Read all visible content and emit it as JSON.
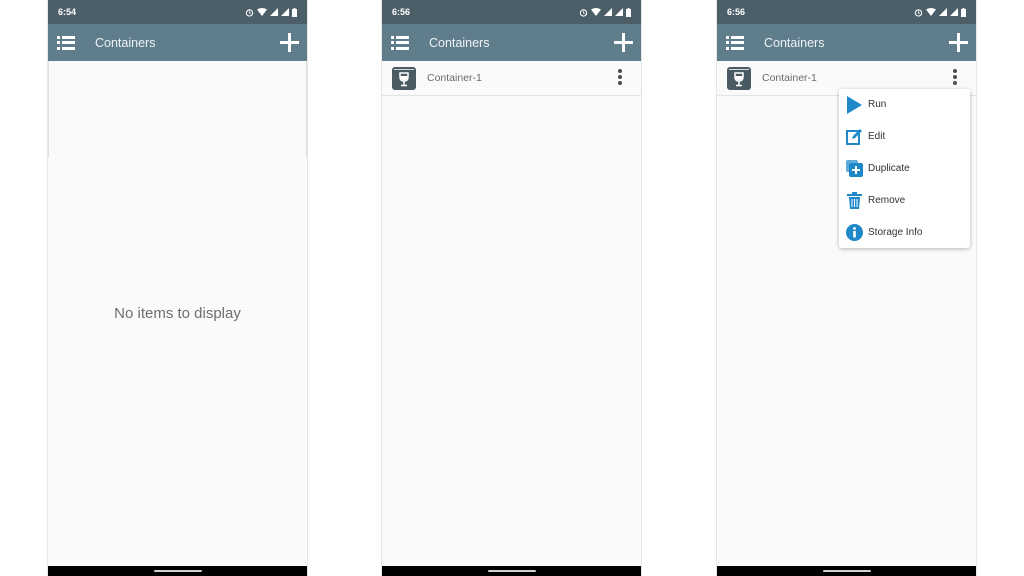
{
  "screens": [
    {
      "status_time": "6:54",
      "app_title": "Containers",
      "empty_message": "No items to display"
    },
    {
      "status_time": "6:56",
      "app_title": "Containers",
      "items": [
        {
          "label": "Container-1",
          "icon": "container-icon"
        }
      ]
    },
    {
      "status_time": "6:56",
      "app_title": "Containers",
      "items": [
        {
          "label": "Container-1",
          "icon": "container-icon"
        }
      ],
      "context_menu": [
        {
          "label": "Run",
          "icon": "play-icon"
        },
        {
          "label": "Edit",
          "icon": "edit-icon"
        },
        {
          "label": "Duplicate",
          "icon": "duplicate-icon"
        },
        {
          "label": "Remove",
          "icon": "trash-icon"
        },
        {
          "label": "Storage Info",
          "icon": "info-icon"
        }
      ]
    }
  ],
  "colors": {
    "statusbar": "#4c5f69",
    "appbar": "#607d8b",
    "accent": "#1e88c8"
  }
}
